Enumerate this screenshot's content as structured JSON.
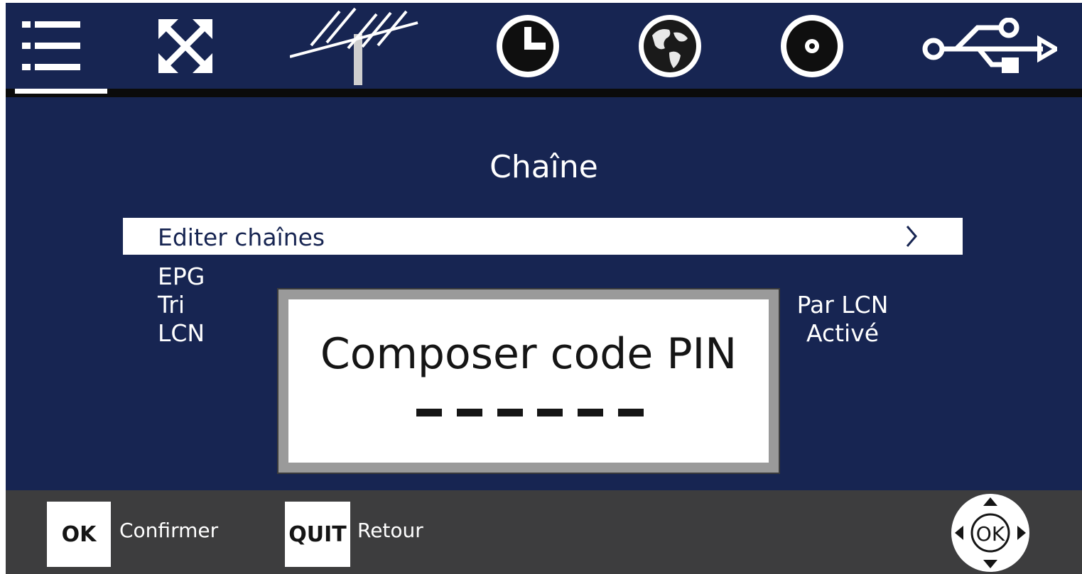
{
  "topbar": {
    "icons": [
      {
        "name": "list-menu-icon",
        "selected": true
      },
      {
        "name": "expand-arrows-icon"
      },
      {
        "name": "antenna-icon"
      },
      {
        "name": "clock-icon"
      },
      {
        "name": "globe-icon"
      },
      {
        "name": "gear-icon"
      },
      {
        "name": "usb-icon"
      }
    ],
    "accent_color": "#ffffff"
  },
  "page": {
    "title": "Chaîne"
  },
  "menu": {
    "items": [
      {
        "label": "Editer chaînes",
        "value": "",
        "selected": true
      },
      {
        "label": "EPG",
        "value": ""
      },
      {
        "label": "Tri",
        "value": "Par LCN"
      },
      {
        "label": "LCN",
        "value": "Activé"
      }
    ]
  },
  "pin_dialog": {
    "title": "Composer code PIN",
    "digits_entered": 0,
    "digits_total": 6
  },
  "footer": {
    "ok_key": "OK",
    "ok_label": "Confirmer",
    "quit_key": "QUIT",
    "quit_label": "Retour",
    "nav_center": "OK"
  },
  "colors": {
    "background": "#172552",
    "bottom_bar": "#3d3d3e",
    "dialog_border": "#9a9a9a"
  }
}
